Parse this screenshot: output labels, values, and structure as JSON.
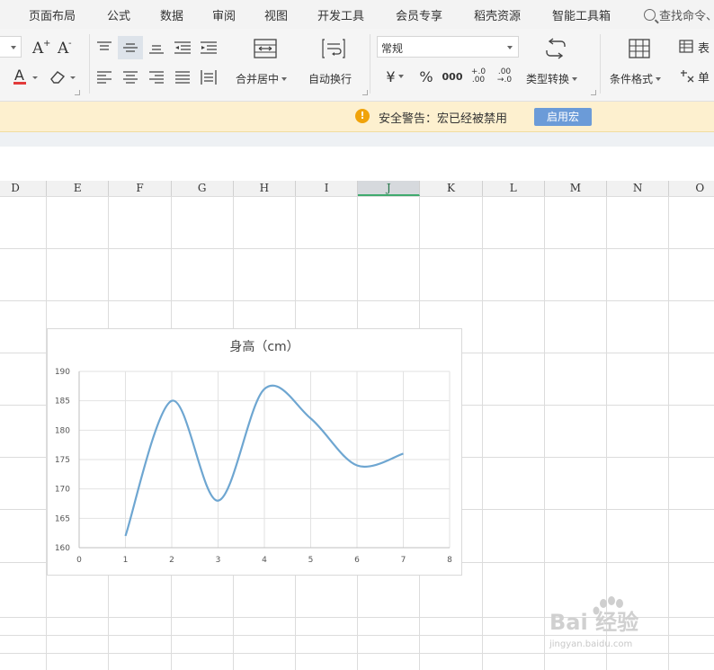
{
  "menu": {
    "items": [
      "页面布局",
      "公式",
      "数据",
      "审阅",
      "视图",
      "开发工具",
      "会员专享",
      "稻壳资源",
      "智能工具箱"
    ],
    "search_label": "查找命令、"
  },
  "ribbon": {
    "font_color_glyph": "A",
    "merge_label": "合并居中",
    "wrap_label": "自动换行",
    "number_format": "常规",
    "currency_glyph": "¥",
    "percent_glyph": "%",
    "thousands_glyph": "000",
    "increase_decimal_glyph": "+.0 .00",
    "decrease_decimal_glyph": ".00 →.0",
    "type_convert_label": "类型转换",
    "conditional_format_label": "条件格式",
    "table_style_label": "表",
    "cell_label": "单"
  },
  "macro_bar": {
    "warning": "安全警告：宏已经被禁用",
    "enable_button": "启用宏"
  },
  "sheet": {
    "columns": [
      "D",
      "E",
      "F",
      "G",
      "H",
      "I",
      "J",
      "K",
      "L",
      "M",
      "N",
      "O"
    ],
    "active_column": "J"
  },
  "chart_data": {
    "type": "line",
    "title": "身高（cm）",
    "x": [
      1,
      2,
      3,
      4,
      5,
      6,
      7
    ],
    "values": [
      162,
      185,
      168,
      187,
      182,
      174,
      176
    ],
    "xlim": [
      0,
      8
    ],
    "ylim": [
      160,
      190
    ],
    "xticks": [
      0,
      1,
      2,
      3,
      4,
      5,
      6,
      7,
      8
    ],
    "yticks": [
      160,
      165,
      170,
      175,
      180,
      185,
      190
    ],
    "grid": true,
    "smooth": true,
    "color": "#6ea6d1"
  },
  "watermark": {
    "text_main": "Bai 经验",
    "text_url": "jingyan.baidu.com"
  },
  "colors": {
    "accent_green": "#217346",
    "warning_orange": "#f0a30a",
    "enable_blue": "#6b9bd8",
    "line_blue": "#6ea6d1"
  }
}
